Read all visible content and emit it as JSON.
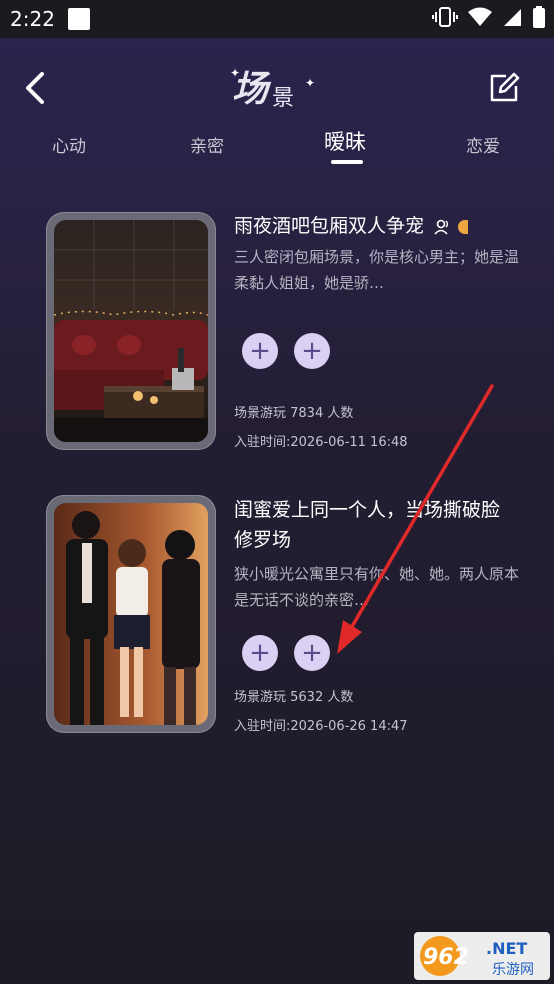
{
  "status_bar": {
    "time": "2:22"
  },
  "header": {
    "title_main": "场",
    "title_sub": "景"
  },
  "tabs": [
    {
      "label": "心动"
    },
    {
      "label": "亲密"
    },
    {
      "label": "暧昧",
      "active": true
    },
    {
      "label": "恋爱"
    }
  ],
  "cards": [
    {
      "title": "雨夜酒吧包厢双人争宠",
      "description": "三人密闭包厢场景，你是核心男主；她是温柔黏人姐姐，她是骄…",
      "plays": "场景游玩 7834 人数",
      "joined": "入驻时间:2026-06-11 16:48"
    },
    {
      "title": "闺蜜爱上同一个人，当场撕破脸修罗场",
      "description": "狭小暖光公寓里只有你、她、她。两人原本是无话不谈的亲密…",
      "plays": "场景游玩 5632 人数",
      "joined": "入驻时间:2026-06-26 14:47"
    }
  ],
  "icons": {
    "back": "back-arrow-icon",
    "edit": "edit-icon",
    "plus": "plus-icon",
    "users": "users-icon"
  },
  "colors": {
    "accent_purple": "#d9d0f3",
    "arrow_red": "#e02a2a"
  },
  "watermark": {
    "text": "962.NET",
    "subtext": "乐游网"
  }
}
